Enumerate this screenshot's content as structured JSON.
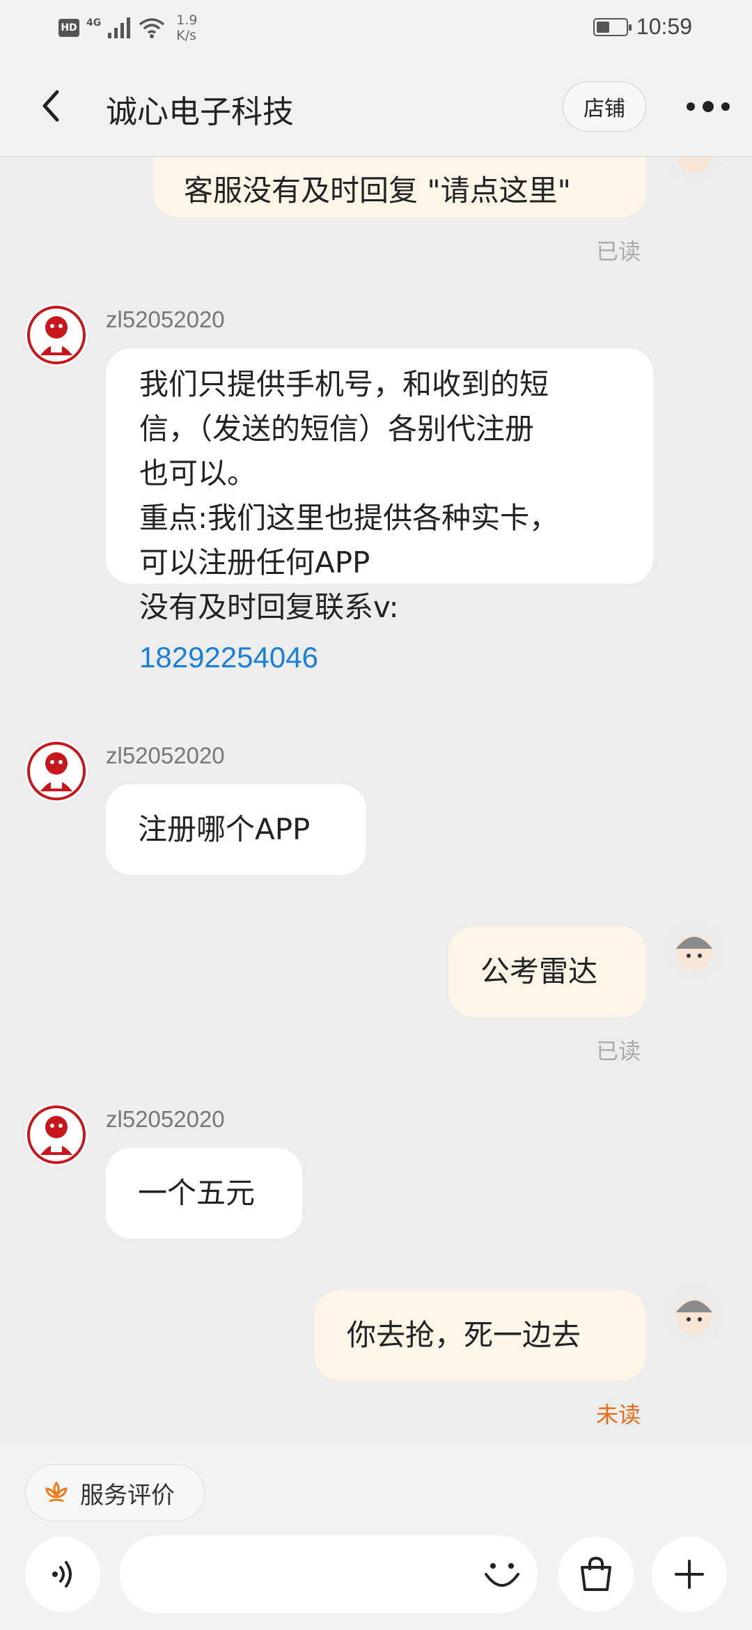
{
  "status_bar": {
    "hd": "HD",
    "network": "4G",
    "speed_value": "1.9",
    "speed_unit": "K/s",
    "time": "10:59"
  },
  "header": {
    "title": "诚心电子科技",
    "shop_label": "店铺"
  },
  "messages": [
    {
      "type": "sent",
      "text": "客服没有及时回复 \"请点这里\"",
      "status": "已读"
    },
    {
      "type": "received",
      "sender": "zl52052020",
      "lines": [
        "我们只提供手机号，和收到的短",
        "信，（发送的短信）各别代注册",
        "也可以。",
        "重点:我们这里也提供各种实卡，",
        "可以注册任何APP",
        "没有及时回复联系v:"
      ],
      "link": "18292254046"
    },
    {
      "type": "received",
      "sender": "zl52052020",
      "text": "注册哪个APP"
    },
    {
      "type": "sent",
      "text": "公考雷达",
      "status": "已读"
    },
    {
      "type": "received",
      "sender": "zl52052020",
      "text": "一个五元"
    },
    {
      "type": "sent",
      "text": "你去抢，死一边去",
      "status": "未读"
    }
  ],
  "bottom": {
    "service_eval_label": "服务评价",
    "input_placeholder": ""
  },
  "colors": {
    "sent_bubble": "#fdf6e8",
    "received_bubble": "#ffffff",
    "link": "#1a7fd8",
    "unread": "#e86c1a",
    "seller_avatar": "#c8161d"
  }
}
